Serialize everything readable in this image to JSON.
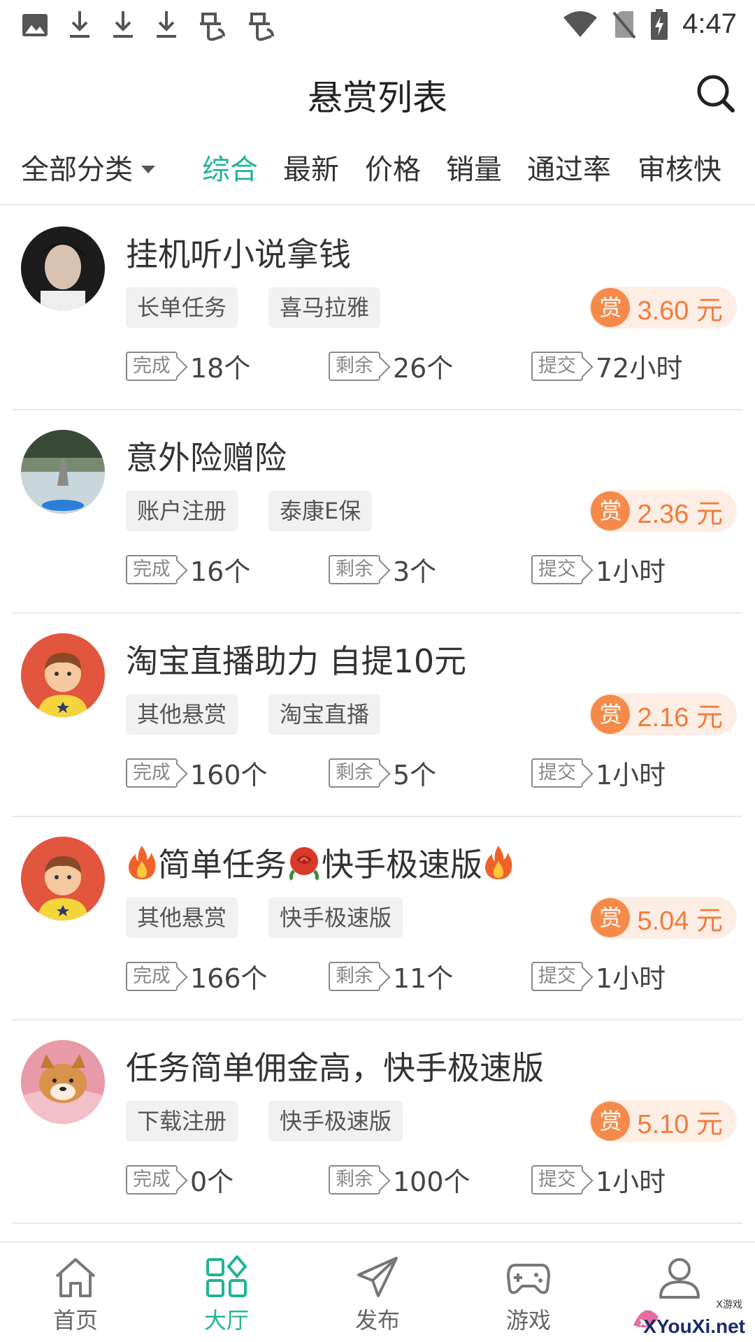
{
  "status_bar": {
    "time": "4:47",
    "icons": [
      "image-icon",
      "download-icon",
      "download-icon",
      "download-icon",
      "bug-icon",
      "bug-icon",
      "wifi-icon",
      "no-sim-icon",
      "battery-charging-icon"
    ]
  },
  "header": {
    "title": "悬赏列表",
    "search_icon": "search-icon"
  },
  "filters": {
    "category": "全部分类",
    "sort_tabs": [
      "综合",
      "最新",
      "价格",
      "销量",
      "通过率",
      "审核快"
    ],
    "active_tab": "综合"
  },
  "colors": {
    "accent": "#20b496",
    "reward": "#f07c3c",
    "reward_bg": "#fdeee5"
  },
  "tasks": [
    {
      "title": "挂机听小说拿钱",
      "tags": [
        "长单任务",
        "喜马拉雅"
      ],
      "reward_label": "赏",
      "reward": "3.60 元",
      "stats": [
        {
          "label": "完成",
          "value": "18个"
        },
        {
          "label": "剩余",
          "value": "26个"
        },
        {
          "label": "提交",
          "value": "72小时"
        }
      ]
    },
    {
      "title": "意外险赠险",
      "tags": [
        "账户注册",
        "泰康E保"
      ],
      "reward_label": "赏",
      "reward": "2.36 元",
      "stats": [
        {
          "label": "完成",
          "value": "16个"
        },
        {
          "label": "剩余",
          "value": "3个"
        },
        {
          "label": "提交",
          "value": "1小时"
        }
      ]
    },
    {
      "title": "淘宝直播助力 自提10元",
      "tags": [
        "其他悬赏",
        "淘宝直播"
      ],
      "reward_label": "赏",
      "reward": "2.16 元",
      "stats": [
        {
          "label": "完成",
          "value": "160个"
        },
        {
          "label": "剩余",
          "value": "5个"
        },
        {
          "label": "提交",
          "value": "1小时"
        }
      ]
    },
    {
      "title_parts": [
        "简单任务",
        "快手极速版"
      ],
      "title_icons": [
        "fire-icon",
        "rose-icon",
        "fire-icon"
      ],
      "tags": [
        "其他悬赏",
        "快手极速版"
      ],
      "reward_label": "赏",
      "reward": "5.04 元",
      "stats": [
        {
          "label": "完成",
          "value": "166个"
        },
        {
          "label": "剩余",
          "value": "11个"
        },
        {
          "label": "提交",
          "value": "1小时"
        }
      ]
    },
    {
      "title": "任务简单佣金高，快手极速版",
      "tags": [
        "下载注册",
        "快手极速版"
      ],
      "reward_label": "赏",
      "reward": "5.10 元",
      "stats": [
        {
          "label": "完成",
          "value": "0个"
        },
        {
          "label": "剩余",
          "value": "100个"
        },
        {
          "label": "提交",
          "value": "1小时"
        }
      ]
    }
  ],
  "bottom_nav": [
    {
      "label": "首页",
      "icon": "home-icon"
    },
    {
      "label": "大厅",
      "icon": "hall-icon"
    },
    {
      "label": "发布",
      "icon": "send-icon"
    },
    {
      "label": "游戏",
      "icon": "gamepad-icon"
    },
    {
      "label": "",
      "icon": "profile-icon"
    }
  ],
  "watermark": {
    "text": "XYouXi.net",
    "small": "X游戏"
  }
}
